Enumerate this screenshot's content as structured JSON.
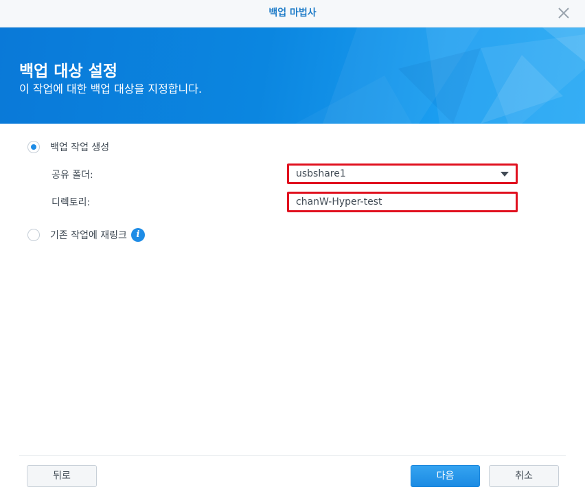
{
  "dialog": {
    "title": "백업 마법사",
    "close_icon": "close-icon"
  },
  "banner": {
    "heading": "백업 대상 설정",
    "subheading": "이 작업에 대한 백업 대상을 지정합니다."
  },
  "options": {
    "create_task": {
      "label": "백업 작업 생성",
      "selected": true
    },
    "shared_folder": {
      "label": "공유 폴더:",
      "value": "usbshare1"
    },
    "directory": {
      "label": "디렉토리:",
      "value": "chanW-Hyper-test"
    },
    "relink_task": {
      "label": "기존 작업에 재링크",
      "selected": false,
      "info_icon": "info-icon"
    }
  },
  "footer": {
    "back_label": "뒤로",
    "next_label": "다음",
    "cancel_label": "취소"
  },
  "colors": {
    "accent": "#1e8ce6",
    "highlight_border": "#e0101e",
    "banner_blue": "#0b86e0"
  }
}
